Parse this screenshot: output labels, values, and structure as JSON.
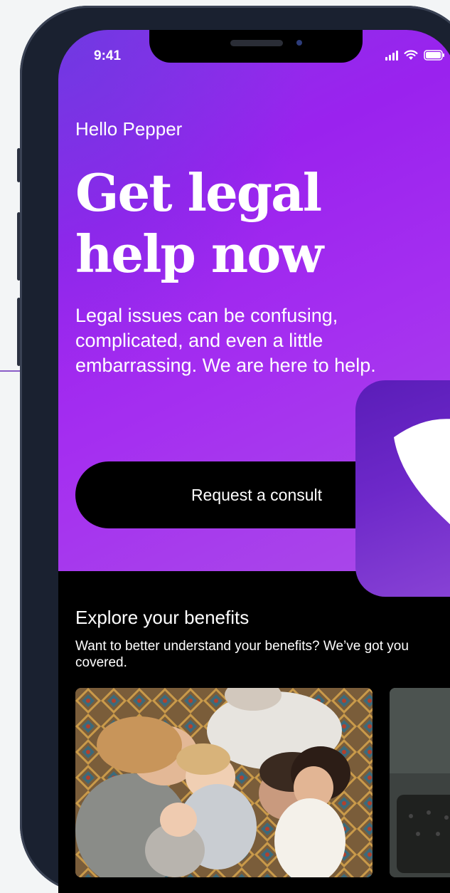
{
  "status_bar": {
    "time": "9:41",
    "icons": [
      "signal-icon",
      "wifi-icon",
      "battery-icon"
    ]
  },
  "hero": {
    "greeting": "Hello Pepper",
    "headline": "Get legal help now",
    "intro": "Legal issues can be confusing, complicated, and even a little embarrassing. We are here to help.",
    "cta_label": "Request a consult"
  },
  "benefits": {
    "title": "Explore your benefits",
    "subtitle": "Want to better understand your benefits? We’ve got you covered.",
    "cards": [
      {
        "image": "family-lying-on-rug-photo"
      },
      {
        "image": "dark-leather-sofa-photo"
      }
    ]
  },
  "badge": {
    "icon": "shield-icon"
  },
  "colors": {
    "hero_gradient_start": "#8a35e8",
    "hero_gradient_end": "#a94ae8",
    "button_bg": "#000000",
    "screen_bg": "#000000",
    "text": "#ffffff",
    "badge_purple": "#6d28c9"
  }
}
